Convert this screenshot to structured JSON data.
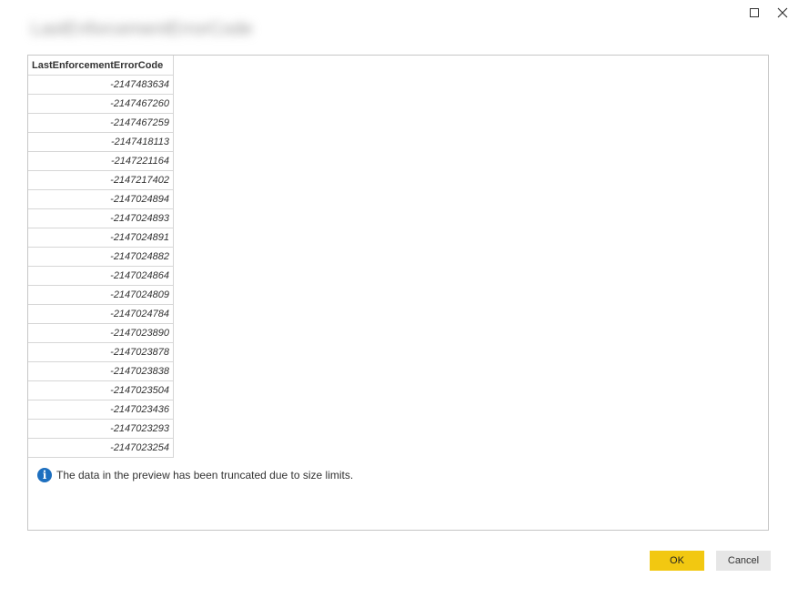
{
  "window": {
    "title": "LastEnforcementErrorCode",
    "maximize_icon": "maximize-icon",
    "close_icon": "close-icon"
  },
  "table": {
    "columns": [
      "LastEnforcementErrorCode"
    ],
    "rows": [
      "-2147483634",
      "-2147467260",
      "-2147467259",
      "-2147418113",
      "-2147221164",
      "-2147217402",
      "-2147024894",
      "-2147024893",
      "-2147024891",
      "-2147024882",
      "-2147024864",
      "-2147024809",
      "-2147024784",
      "-2147023890",
      "-2147023878",
      "-2147023838",
      "-2147023504",
      "-2147023436",
      "-2147023293",
      "-2147023254"
    ]
  },
  "notice": {
    "icon": "info-icon",
    "text": "The data in the preview has been truncated due to size limits."
  },
  "buttons": {
    "ok_label": "OK",
    "cancel_label": "Cancel"
  },
  "colors": {
    "ok_button": "#f2c811",
    "cancel_button": "#e6e6e6",
    "info_icon": "#1d6fbf"
  }
}
